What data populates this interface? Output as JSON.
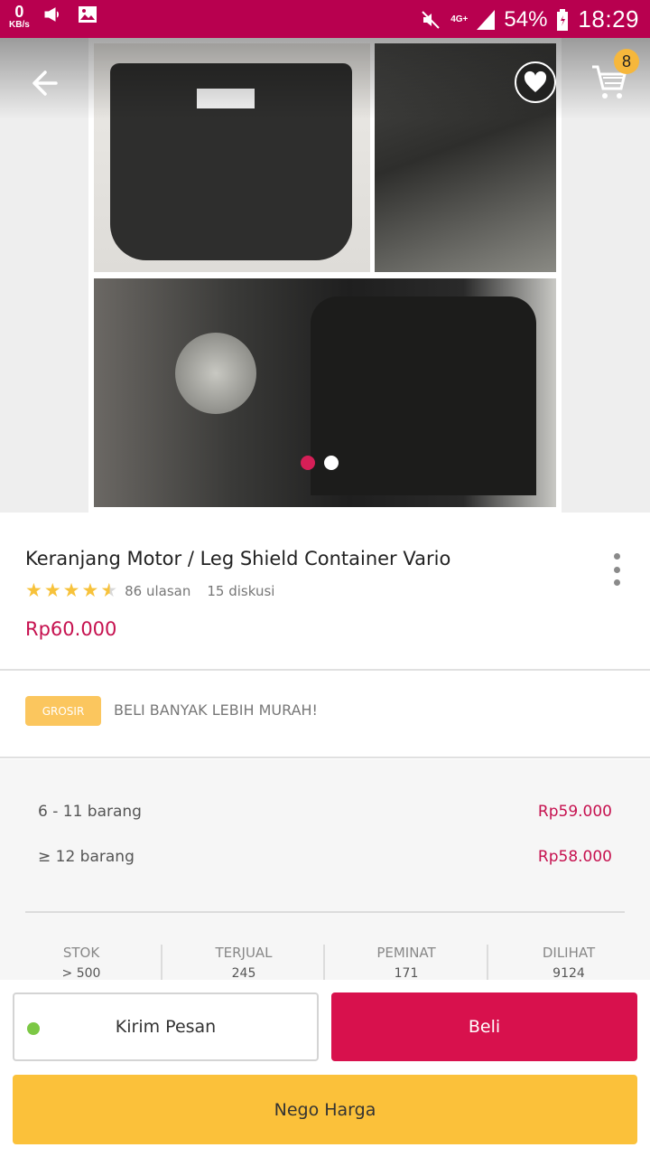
{
  "status_bar": {
    "speed_value": "0",
    "speed_unit": "KB/s",
    "network": "4G+",
    "battery": "54%",
    "time": "18:29",
    "bg_color": "#b8004f"
  },
  "header": {
    "back_icon": "arrow-left-icon",
    "wishlist_icon": "heart-icon",
    "cart_icon": "cart-icon",
    "cart_count": "8"
  },
  "gallery": {
    "image_count": 2,
    "active_index": 0
  },
  "product": {
    "title": "Keranjang Motor / Leg Shield Container Vario",
    "rating": 4.5,
    "reviews": "86 ulasan",
    "discussions": "15 diskusi",
    "price": "Rp60.000",
    "price_color": "#c6114f"
  },
  "grosir": {
    "badge": "GROSIR",
    "text": "BELI BANYAK LEBIH MURAH!",
    "tiers": [
      {
        "qty": "6 - 11 barang",
        "price": "Rp59.000"
      },
      {
        "qty": "≥ 12 barang",
        "price": "Rp58.000"
      }
    ]
  },
  "stats": [
    {
      "label": "STOK",
      "value": "> 500"
    },
    {
      "label": "TERJUAL",
      "value": "245"
    },
    {
      "label": "PEMINAT",
      "value": "171"
    },
    {
      "label": "DILIHAT",
      "value": "9124"
    }
  ],
  "actions": {
    "message": "Kirim Pesan",
    "buy": "Beli",
    "negotiate": "Nego Harga",
    "buy_color": "#d8114d",
    "nego_color": "#fbc13a"
  }
}
